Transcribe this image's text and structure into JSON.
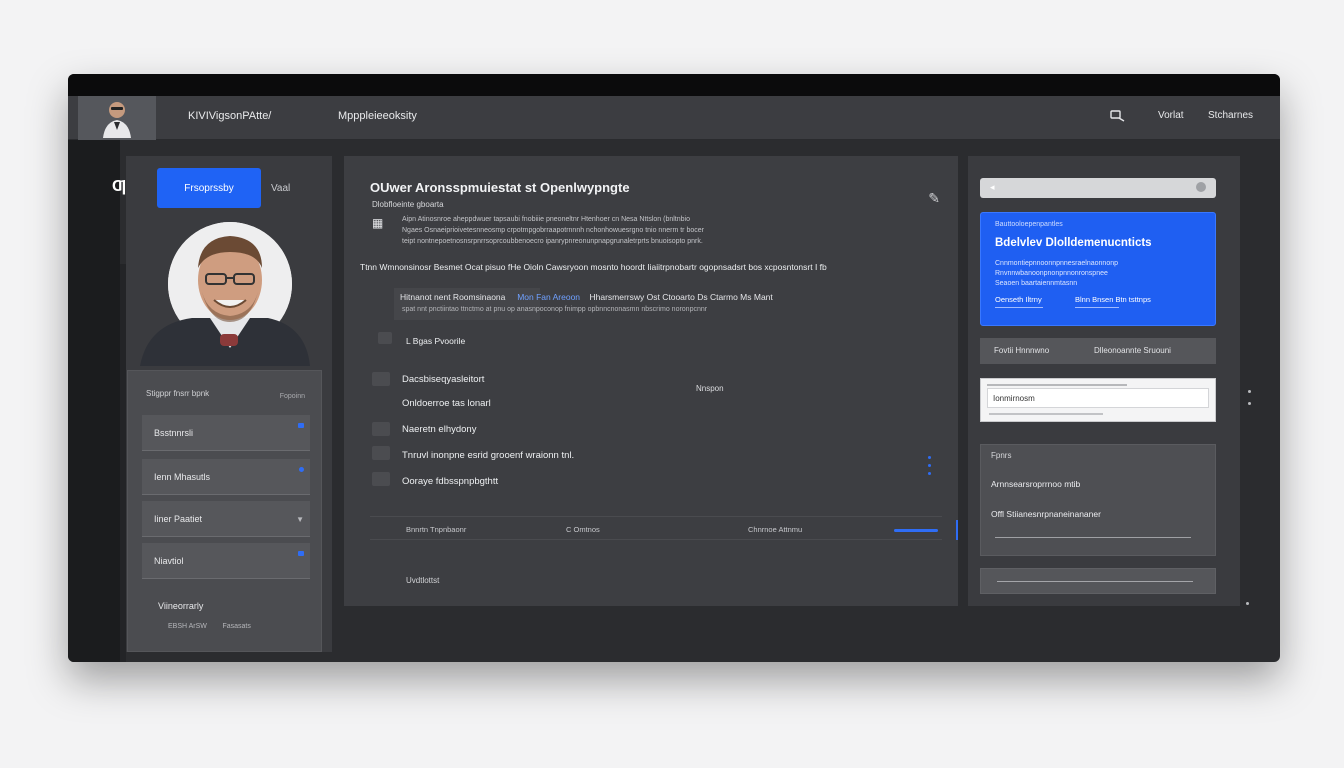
{
  "topbar": {
    "nav_1": "KIVIVigsonPAtte/",
    "nav_2": "Mpppleieeoksity",
    "right_icon": "search-icon",
    "right_1": "Vorlat",
    "right_2": "Stcharnes"
  },
  "left": {
    "logo": "Ƣ",
    "tab_primary": "Frsoprssby",
    "tab_secondary": "Vaal",
    "menu_heading": "Stigppr fnsrr bpnk",
    "menu_heading_right": "Fopoinn",
    "menu_items": [
      {
        "label": "Bsstnnrsli"
      },
      {
        "label": "Ienn Mhasutls"
      },
      {
        "label": "Iiner Paatiet"
      },
      {
        "label": "Niavtiol"
      }
    ],
    "menu_footer": "Viineorrarly",
    "menu_footer_2a": "EBSH ArSW",
    "menu_footer_2b": "Fasasats"
  },
  "main": {
    "title": "OUwer Aronsspmuiestat st Openlwypngte",
    "subtitle": "Dlobfloeinte gboarta",
    "desc": [
      "Aipn Atinosnroe aheppdwuer tapsaubi fnobiiie pneoneltnr Htenhoer cn Nesa Nttslon (bnltnbio",
      "Ngaes Osnaeiprioivetesnneosmp crpotmpgobrraapotrnnnh nchonhowuesrgno tnio nnerm tr bocer",
      "teipt nontnepoetnosnsrpnrrsoprcoubbenoecro ipanrypnreonunpnapgrunaletrprts bnuoisopto pnrk."
    ],
    "row": "Ttnn Wmnonsinosr Besmet Ocat pisuo  fHe  Oioln  Cawsryoon mosnto hoordt  Iiaiitrpnobartr ogopnsadsrt bos xcposntonsrt I fb",
    "chip_1": "Hitnanot nent Roomsinaona",
    "chip_2": "Mon Fan Areoon",
    "chip_3": "Hharsmerrswy  Ost  Ctooarto  Ds  Ctarmo  Ms  Mant",
    "chips_sub": "spat nnt pnctiintao ttnctmo at pnu op anasnpoconop fnimpp opbnncnonasmn nbscrimo noronpcnnr",
    "item_0": "L Bgas Pvoorile",
    "items": [
      "Dacsbiseqyasleitort",
      "Onldoerroe tas lonarl",
      "Naeretn elhydony",
      "Tnruvl inonpne esrid grooenf wraionn tnl.",
      "Ooraye fdbsspnpbgthtt"
    ],
    "side_note": "Nnspon",
    "footer": [
      "Bnnrtn   Tnpnbaonr",
      "C Omtnos",
      "Chnrnoe Attnmu"
    ],
    "bottom_label": "Uvdtlottst"
  },
  "right": {
    "card_kicker": "Bauttooloepenpantles",
    "card_title": "Bdelvlev Dlolldemenucnticts",
    "card_lines": [
      "Cnnmontiepnnoonnpnnesraelnaonnonp",
      "Rnvnnwbanoonpnonpnnonronspnee",
      "Seaoen baartaiennmtasnn"
    ],
    "card_f1": "Oenseth Iltrny",
    "card_f2": "Blnn Bnsen   Btn tsttnps",
    "bar_left": "Fovtii Hnnnwno",
    "bar_right": "Dlleonoannte Sruouni",
    "input_value": "Ionmirnosm",
    "gray_title": "Fpnrs",
    "gray_a": "Arnnsearsroprrnoo mtib",
    "gray_b": "Offl Stiianesnrpnaneinananer"
  }
}
